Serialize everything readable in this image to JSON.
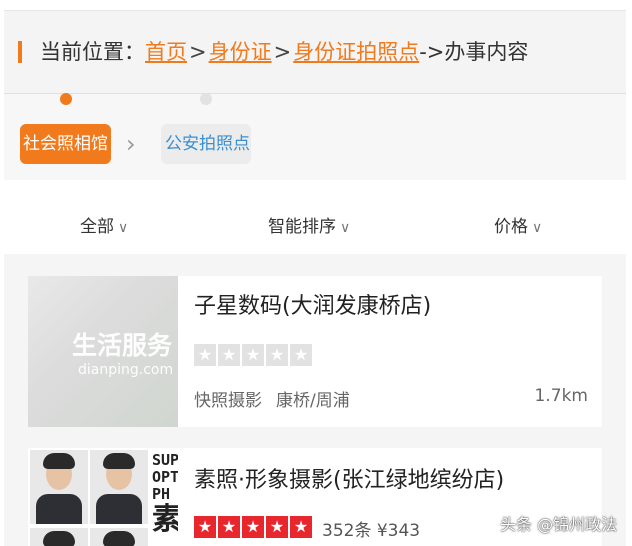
{
  "breadcrumb": {
    "prefix": "当前位置：",
    "items": [
      "首页",
      "身份证",
      "身份证拍照点"
    ],
    "separator": ">",
    "tail": "->办事内容"
  },
  "categories": {
    "active": "社会照相馆",
    "next": "公安拍照点",
    "arrow": "›"
  },
  "filters": [
    {
      "label": "全部"
    },
    {
      "label": "智能排序"
    },
    {
      "label": "价格"
    }
  ],
  "listings": [
    {
      "name": "子星数码(大润发康桥店)",
      "thumb_watermark": "生活服务",
      "thumb_site": "dianping.com",
      "rating": 0,
      "tag": "快照摄影",
      "area": "康桥/周浦",
      "distance": "1.7km"
    },
    {
      "name": "素照·形象摄影(张江绿地缤纷店)",
      "thumb_brand_lines": [
        "SUP",
        "OPT",
        "PH"
      ],
      "thumb_brand_big": "素",
      "rating": 5,
      "reviews": "352条",
      "price": "¥343"
    }
  ],
  "watermark": "头条 @锦州政法",
  "colors": {
    "accent": "#f07a1c",
    "link_blue": "#3a8fd0",
    "star_red": "#e8262e"
  }
}
